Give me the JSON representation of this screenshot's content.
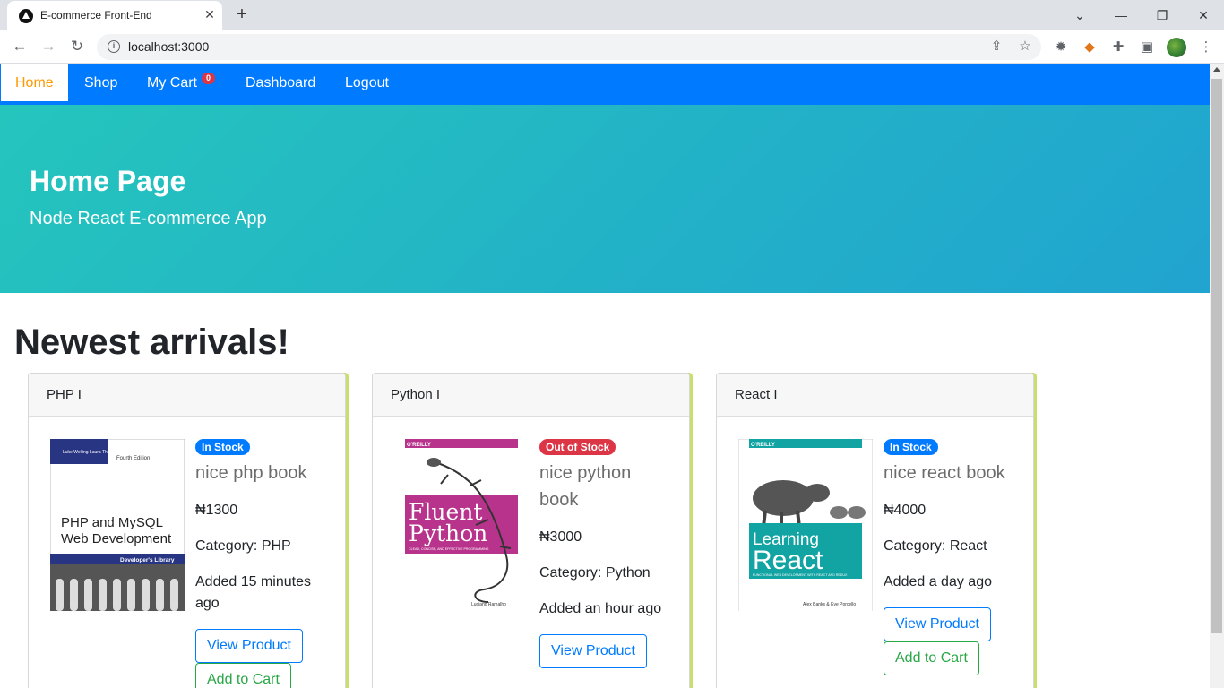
{
  "browser": {
    "tab_title": "E-commerce Front-End",
    "url": "localhost:3000"
  },
  "navbar": {
    "items": [
      {
        "label": "Home"
      },
      {
        "label": "Shop"
      },
      {
        "label": "My Cart"
      },
      {
        "label": "Dashboard"
      },
      {
        "label": "Logout"
      }
    ],
    "cart_count": "0"
  },
  "jumbotron": {
    "title": "Home Page",
    "subtitle": "Node React E-commerce App"
  },
  "section_title": "Newest arrivals!",
  "products": [
    {
      "header": "PHP I",
      "stock": "In Stock",
      "name": "nice php book",
      "price": "₦1300",
      "category": "Category: PHP",
      "added": "Added 15 minutes ago",
      "view_label": "View Product",
      "cart_label": "Add to Cart",
      "cover": {
        "authors": "Luke Welling\nLaura Thomson",
        "edition": "Fourth Edition",
        "title_a": "PHP and MySQL",
        "title_b": "Web Development",
        "series": "Developer's Library"
      }
    },
    {
      "header": "Python I",
      "stock": "Out of Stock",
      "name": "nice python book",
      "price": "₦3000",
      "category": "Category: Python",
      "added": "Added an hour ago",
      "view_label": "View Product",
      "cover": {
        "publisher": "O'REILLY",
        "title_a": "Fluent",
        "title_b": "Python",
        "tagline": "CLEAR, CONCISE, AND EFFECTIVE PROGRAMMING",
        "author": "Luciano Ramalho"
      }
    },
    {
      "header": "React I",
      "stock": "In Stock",
      "name": "nice react book",
      "price": "₦4000",
      "category": "Category: React",
      "added": "Added a day ago",
      "view_label": "View Product",
      "cart_label": "Add to Cart",
      "cover": {
        "publisher": "O'REILLY",
        "title_a": "Learning",
        "title_b": "React",
        "tagline": "FUNCTIONAL WEB DEVELOPMENT WITH REACT AND REDUX",
        "author": "Alex Banks & Eve Porcello"
      }
    }
  ],
  "colors": {
    "navbar": "#007bff",
    "active_nav_text": "#ff9900",
    "in_stock": "#007bff",
    "out_of_stock": "#dc3545",
    "jumbotron_start": "#25c5bd",
    "jumbotron_end": "#21a4d0"
  }
}
